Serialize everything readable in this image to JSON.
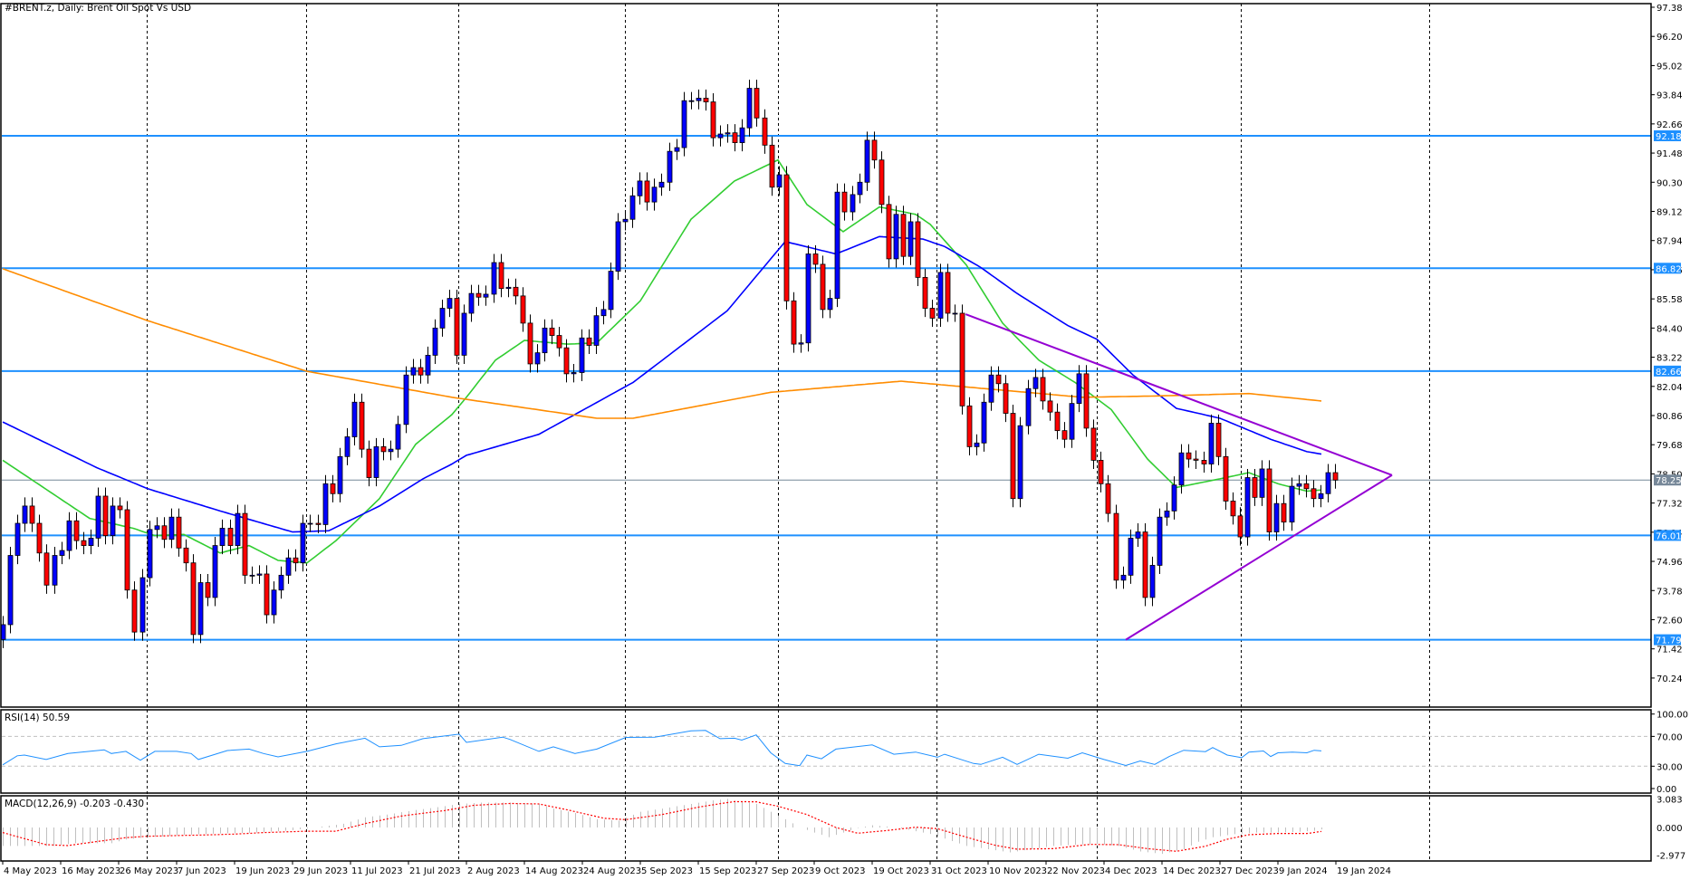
{
  "chart_data": {
    "type": "candlestick",
    "title": "#BRENT.z, Daily:  Brent Oil Spot Vs USD",
    "symbol": "#BRENT.z",
    "timeframe": "Daily",
    "price_axis": {
      "ylim": [
        69.3,
        97.6
      ],
      "ticks": [
        "97.38",
        "96.20",
        "95.02",
        "93.84",
        "92.66",
        "91.48",
        "90.30",
        "89.12",
        "87.94",
        "86.76",
        "85.58",
        "84.40",
        "83.22",
        "82.04",
        "80.86",
        "79.68",
        "78.50",
        "77.32",
        "76.14",
        "74.96",
        "73.78",
        "72.60",
        "71.42",
        "70.24"
      ]
    },
    "date_labels": [
      "4 May 2023",
      "16 May 2023",
      "26 May 2023",
      "7 Jun 2023",
      "19 Jun 2023",
      "29 Jun 2023",
      "11 Jul 2023",
      "21 Jul 2023",
      "2 Aug 2023",
      "14 Aug 2023",
      "24 Aug 2023",
      "5 Sep 2023",
      "15 Sep 2023",
      "27 Sep 2023",
      "9 Oct 2023",
      "19 Oct 2023",
      "31 Oct 2023",
      "10 Nov 2023",
      "22 Nov 2023",
      "4 Dec 2023",
      "14 Dec 2023",
      "27 Dec 2023",
      "9 Jan 2024",
      "19 Jan 2024"
    ],
    "month_separators_bar_index": [
      19.9,
      41.9,
      62.9,
      85.9,
      107,
      128.9,
      151,
      170.9,
      196.9
    ],
    "wick": 0.35,
    "closes": [
      72.4,
      75.2,
      76.5,
      77.2,
      76.5,
      75.3,
      74.0,
      75.2,
      75.4,
      76.6,
      75.8,
      75.6,
      75.9,
      77.6,
      76.0,
      77.2,
      77.05,
      73.8,
      72.1,
      74.3,
      76.25,
      76.4,
      75.85,
      76.75,
      75.5,
      74.9,
      72.0,
      74.1,
      73.5,
      75.6,
      76.3,
      75.6,
      76.9,
      74.4,
      74.4,
      74.45,
      72.8,
      73.8,
      74.4,
      75.1,
      74.9,
      76.5,
      76.5,
      76.45,
      78.1,
      77.7,
      79.2,
      80.0,
      81.4,
      79.5,
      78.35,
      79.6,
      79.4,
      79.5,
      80.5,
      82.5,
      82.8,
      82.5,
      83.3,
      84.4,
      85.2,
      85.6,
      83.3,
      85.0,
      85.8,
      85.65,
      85.77,
      87.05,
      86.0,
      86.05,
      85.7,
      84.6,
      82.95,
      83.4,
      84.4,
      84.1,
      83.6,
      82.55,
      82.6,
      84.0,
      83.7,
      84.9,
      85.15,
      86.7,
      88.7,
      88.8,
      89.75,
      90.35,
      89.5,
      90.1,
      90.3,
      91.55,
      91.7,
      93.6,
      93.6,
      93.7,
      93.55,
      92.1,
      92.25,
      92.3,
      91.9,
      92.5,
      94.1,
      92.9,
      91.8,
      90.1,
      90.6,
      85.5,
      83.75,
      83.8,
      87.4,
      86.98,
      85.15,
      85.6,
      89.9,
      89.1,
      89.8,
      90.3,
      92.0,
      91.2,
      89.4,
      87.2,
      89.0,
      87.3,
      88.7,
      86.45,
      85.2,
      84.8,
      86.65,
      85.0,
      85.0,
      81.25,
      79.6,
      79.75,
      81.4,
      82.5,
      82.15,
      80.95,
      77.5,
      80.45,
      81.95,
      82.4,
      81.45,
      81.0,
      80.25,
      79.9,
      81.35,
      82.55,
      80.35,
      79.05,
      78.1,
      76.9,
      74.2,
      74.4,
      75.9,
      76.15,
      73.5,
      74.8,
      76.75,
      77.0,
      78.05,
      79.35,
      79.1,
      79.05,
      78.9,
      80.55,
      79.2,
      77.4,
      76.8,
      75.95,
      78.35,
      77.55,
      78.7,
      76.15,
      77.3,
      76.55,
      78.0,
      78.1,
      77.9,
      77.5,
      77.7,
      78.55,
      78.25
    ],
    "moving_averages": [
      {
        "name": "MA fast",
        "color": "#32cd32",
        "points": [
          [
            0,
            79.05
          ],
          [
            12,
            76.7
          ],
          [
            18,
            76.3
          ],
          [
            21,
            76.0
          ],
          [
            25,
            76.05
          ],
          [
            30,
            75.3
          ],
          [
            34,
            75.6
          ],
          [
            38,
            75.0
          ],
          [
            42,
            74.9
          ],
          [
            46,
            75.8
          ],
          [
            52,
            77.5
          ],
          [
            57,
            79.7
          ],
          [
            62,
            80.9
          ],
          [
            64,
            81.6
          ],
          [
            68,
            83.1
          ],
          [
            72,
            83.9
          ],
          [
            78,
            83.75
          ],
          [
            82,
            83.8
          ],
          [
            88,
            85.5
          ],
          [
            95,
            88.8
          ],
          [
            101,
            90.35
          ],
          [
            107,
            91.2
          ],
          [
            111,
            89.4
          ],
          [
            116,
            88.3
          ],
          [
            121,
            89.3
          ],
          [
            126,
            89.0
          ],
          [
            128,
            88.6
          ],
          [
            133,
            86.95
          ],
          [
            138,
            84.6
          ],
          [
            143,
            83.1
          ],
          [
            148,
            82.2
          ],
          [
            153,
            81.1
          ],
          [
            158,
            79.1
          ],
          [
            162,
            77.95
          ],
          [
            168,
            78.3
          ],
          [
            172,
            78.55
          ],
          [
            176,
            78.1
          ],
          [
            180,
            77.8
          ],
          [
            182,
            77.85
          ]
        ]
      },
      {
        "name": "MA medium",
        "color": "#0000ff",
        "points": [
          [
            0,
            80.6
          ],
          [
            13,
            78.75
          ],
          [
            20,
            77.9
          ],
          [
            30,
            77.0
          ],
          [
            40,
            76.15
          ],
          [
            45,
            76.2
          ],
          [
            52,
            77.2
          ],
          [
            58,
            78.3
          ],
          [
            62,
            78.9
          ],
          [
            64,
            79.25
          ],
          [
            74,
            80.1
          ],
          [
            87,
            82.2
          ],
          [
            100,
            85.1
          ],
          [
            108,
            87.9
          ],
          [
            115,
            87.4
          ],
          [
            121,
            88.1
          ],
          [
            127,
            88.0
          ],
          [
            130,
            87.7
          ],
          [
            135,
            86.85
          ],
          [
            140,
            85.8
          ],
          [
            147,
            84.5
          ],
          [
            151,
            83.95
          ],
          [
            156,
            82.5
          ],
          [
            162,
            81.15
          ],
          [
            168,
            80.75
          ],
          [
            175,
            79.9
          ],
          [
            180,
            79.4
          ],
          [
            182,
            79.3
          ]
        ]
      },
      {
        "name": "MA slow",
        "color": "#ff8c00",
        "points": [
          [
            0,
            86.8
          ],
          [
            20,
            84.7
          ],
          [
            42,
            82.65
          ],
          [
            62,
            81.6
          ],
          [
            82,
            80.75
          ],
          [
            87,
            80.75
          ],
          [
            106,
            81.8
          ],
          [
            124,
            82.25
          ],
          [
            149,
            81.6
          ],
          [
            159,
            81.65
          ],
          [
            172,
            81.75
          ],
          [
            182,
            81.45
          ]
        ]
      }
    ],
    "horizontal_levels": [
      {
        "value": "92.18",
        "color": "#1e90ff"
      },
      {
        "value": "86.82",
        "color": "#1e90ff"
      },
      {
        "value": "82.66",
        "color": "#1e90ff"
      },
      {
        "value": "76.01",
        "color": "#1e90ff"
      },
      {
        "value": "71.79",
        "color": "#1e90ff"
      }
    ],
    "current_price": {
      "value": "78.25",
      "color": "#778899"
    },
    "trendlines": [
      {
        "name": "upper",
        "from": [
          132.9,
          84.96
        ],
        "to": [
          191.75,
          78.45
        ],
        "color": "#9400d3"
      },
      {
        "name": "lower",
        "from": [
          155,
          71.79
        ],
        "to": [
          191.75,
          78.45
        ],
        "color": "#9400d3"
      }
    ],
    "colors": {
      "bull": "#0000ff",
      "bear": "#ff0000",
      "grid": "#000000"
    },
    "rsi": {
      "label": "RSI(14) 50.59",
      "ticks": [
        "100.00",
        "70.00",
        "30.00",
        "0.00"
      ],
      "levels": [
        70,
        30
      ],
      "color": "#1e90ff",
      "points": [
        [
          0,
          31.8
        ],
        [
          2,
          44
        ],
        [
          3,
          45
        ],
        [
          6,
          39
        ],
        [
          9,
          47
        ],
        [
          14,
          52
        ],
        [
          15,
          47
        ],
        [
          17,
          50
        ],
        [
          19,
          38
        ],
        [
          21,
          50
        ],
        [
          24,
          50
        ],
        [
          26,
          47
        ],
        [
          27,
          39
        ],
        [
          31,
          51
        ],
        [
          34,
          53
        ],
        [
          36,
          47
        ],
        [
          38,
          42.5
        ],
        [
          42,
          50
        ],
        [
          46,
          60
        ],
        [
          50,
          67.5
        ],
        [
          52,
          56
        ],
        [
          55,
          58
        ],
        [
          58,
          67
        ],
        [
          63,
          73
        ],
        [
          64,
          62
        ],
        [
          69,
          69
        ],
        [
          70,
          66
        ],
        [
          74,
          50
        ],
        [
          76,
          56
        ],
        [
          79,
          47
        ],
        [
          82,
          53
        ],
        [
          86,
          68.6
        ],
        [
          90,
          69
        ],
        [
          95,
          77.5
        ],
        [
          97,
          78
        ],
        [
          99,
          67
        ],
        [
          101,
          67.5
        ],
        [
          102,
          65
        ],
        [
          104,
          72
        ],
        [
          106,
          48
        ],
        [
          108,
          33.6
        ],
        [
          110,
          30.7
        ],
        [
          111,
          45
        ],
        [
          113,
          40
        ],
        [
          115,
          53
        ],
        [
          120,
          58.6
        ],
        [
          123,
          46
        ],
        [
          126,
          49
        ],
        [
          129,
          42
        ],
        [
          130,
          46
        ],
        [
          134,
          33.6
        ],
        [
          135,
          32.5
        ],
        [
          138,
          42
        ],
        [
          140,
          32.5
        ],
        [
          143,
          46
        ],
        [
          147,
          40.7
        ],
        [
          149,
          48
        ],
        [
          152,
          39
        ],
        [
          155,
          31
        ],
        [
          157,
          37
        ],
        [
          159,
          32.5
        ],
        [
          161,
          43
        ],
        [
          163,
          51.4
        ],
        [
          166,
          49.6
        ],
        [
          167,
          55
        ],
        [
          169,
          45
        ],
        [
          171,
          41.4
        ],
        [
          172,
          49
        ],
        [
          174,
          50.4
        ],
        [
          175,
          43
        ],
        [
          176,
          48
        ],
        [
          178,
          49
        ],
        [
          180,
          48
        ],
        [
          181,
          51.4
        ],
        [
          182,
          50.59
        ]
      ]
    },
    "macd": {
      "label": "MACD(12,26,9) -0.203 -0.430",
      "ticks": [
        "3.083",
        "0.000",
        "-2.977"
      ],
      "histogram_color": "#c0c0c0",
      "signal_color": "#ff0000",
      "main_points": [
        [
          0,
          -2
        ],
        [
          7,
          -2
        ],
        [
          10,
          -1.7
        ],
        [
          15,
          -1.7
        ],
        [
          17,
          -1.3
        ],
        [
          20,
          -1.05
        ],
        [
          25,
          -0.8
        ],
        [
          30,
          -0.65
        ],
        [
          35,
          -0.55
        ],
        [
          40,
          -0.3
        ],
        [
          44,
          0.1
        ],
        [
          47,
          0.4
        ],
        [
          50,
          1.1
        ],
        [
          53,
          1.4
        ],
        [
          57,
          1.9
        ],
        [
          60,
          2.2
        ],
        [
          63,
          2.55
        ],
        [
          66,
          2.7
        ],
        [
          70,
          2.7
        ],
        [
          74,
          2.55
        ],
        [
          76,
          2.05
        ],
        [
          79,
          1.57
        ],
        [
          82,
          0.9
        ],
        [
          85,
          0.75
        ],
        [
          88,
          1.7
        ],
        [
          91,
          2.05
        ],
        [
          95,
          2.55
        ],
        [
          98,
          2.94
        ],
        [
          100,
          3.1
        ],
        [
          101,
          2.9
        ],
        [
          104,
          2.55
        ],
        [
          106,
          1.7
        ],
        [
          108,
          0.9
        ],
        [
          110,
          0
        ],
        [
          112,
          -0.55
        ],
        [
          114,
          -1.05
        ],
        [
          116,
          -0.55
        ],
        [
          118,
          -0.05
        ],
        [
          120,
          0.25
        ],
        [
          122,
          0.1
        ],
        [
          124,
          -0.1
        ],
        [
          126,
          -0.4
        ],
        [
          128,
          -0.7
        ],
        [
          130,
          -1.2
        ],
        [
          133,
          -2.0
        ],
        [
          136,
          -2.35
        ],
        [
          139,
          -2.7
        ],
        [
          142,
          -2.35
        ],
        [
          145,
          -2.0
        ],
        [
          148,
          -1.86
        ],
        [
          151,
          -1.76
        ],
        [
          154,
          -2.0
        ],
        [
          157,
          -2.6
        ],
        [
          160,
          -2.85
        ],
        [
          163,
          -2.35
        ],
        [
          165,
          -1.55
        ],
        [
          167,
          -1.05
        ],
        [
          170,
          -0.72
        ],
        [
          173,
          -0.55
        ],
        [
          176,
          -0.55
        ],
        [
          179,
          -0.46
        ],
        [
          181,
          -0.35
        ],
        [
          182,
          -0.203
        ]
      ],
      "signal_points": [
        [
          0,
          -0.55
        ],
        [
          6,
          -1.86
        ],
        [
          9,
          -1.96
        ],
        [
          12,
          -1.63
        ],
        [
          17,
          -1.1
        ],
        [
          20,
          -0.95
        ],
        [
          27,
          -0.82
        ],
        [
          32,
          -0.72
        ],
        [
          36,
          -0.55
        ],
        [
          42,
          -0.4
        ],
        [
          46,
          -0.4
        ],
        [
          50,
          0.42
        ],
        [
          55,
          1.24
        ],
        [
          61,
          1.83
        ],
        [
          65,
          2.4
        ],
        [
          70,
          2.6
        ],
        [
          74,
          2.55
        ],
        [
          78,
          1.9
        ],
        [
          83,
          1.0
        ],
        [
          86,
          0.85
        ],
        [
          91,
          1.4
        ],
        [
          96,
          2.2
        ],
        [
          100,
          2.7
        ],
        [
          101,
          2.8
        ],
        [
          104,
          2.78
        ],
        [
          107,
          2.3
        ],
        [
          111,
          1.4
        ],
        [
          115,
          0
        ],
        [
          118,
          -0.62
        ],
        [
          122,
          -0.33
        ],
        [
          126,
          0.03
        ],
        [
          129,
          -0.13
        ],
        [
          133,
          -1.05
        ],
        [
          137,
          -1.93
        ],
        [
          140,
          -2.35
        ],
        [
          145,
          -2.29
        ],
        [
          150,
          -1.83
        ],
        [
          154,
          -1.86
        ],
        [
          158,
          -2.29
        ],
        [
          162,
          -2.58
        ],
        [
          166,
          -2.03
        ],
        [
          169,
          -1.27
        ],
        [
          172,
          -0.78
        ],
        [
          176,
          -0.65
        ],
        [
          180,
          -0.65
        ],
        [
          182,
          -0.43
        ]
      ]
    }
  }
}
